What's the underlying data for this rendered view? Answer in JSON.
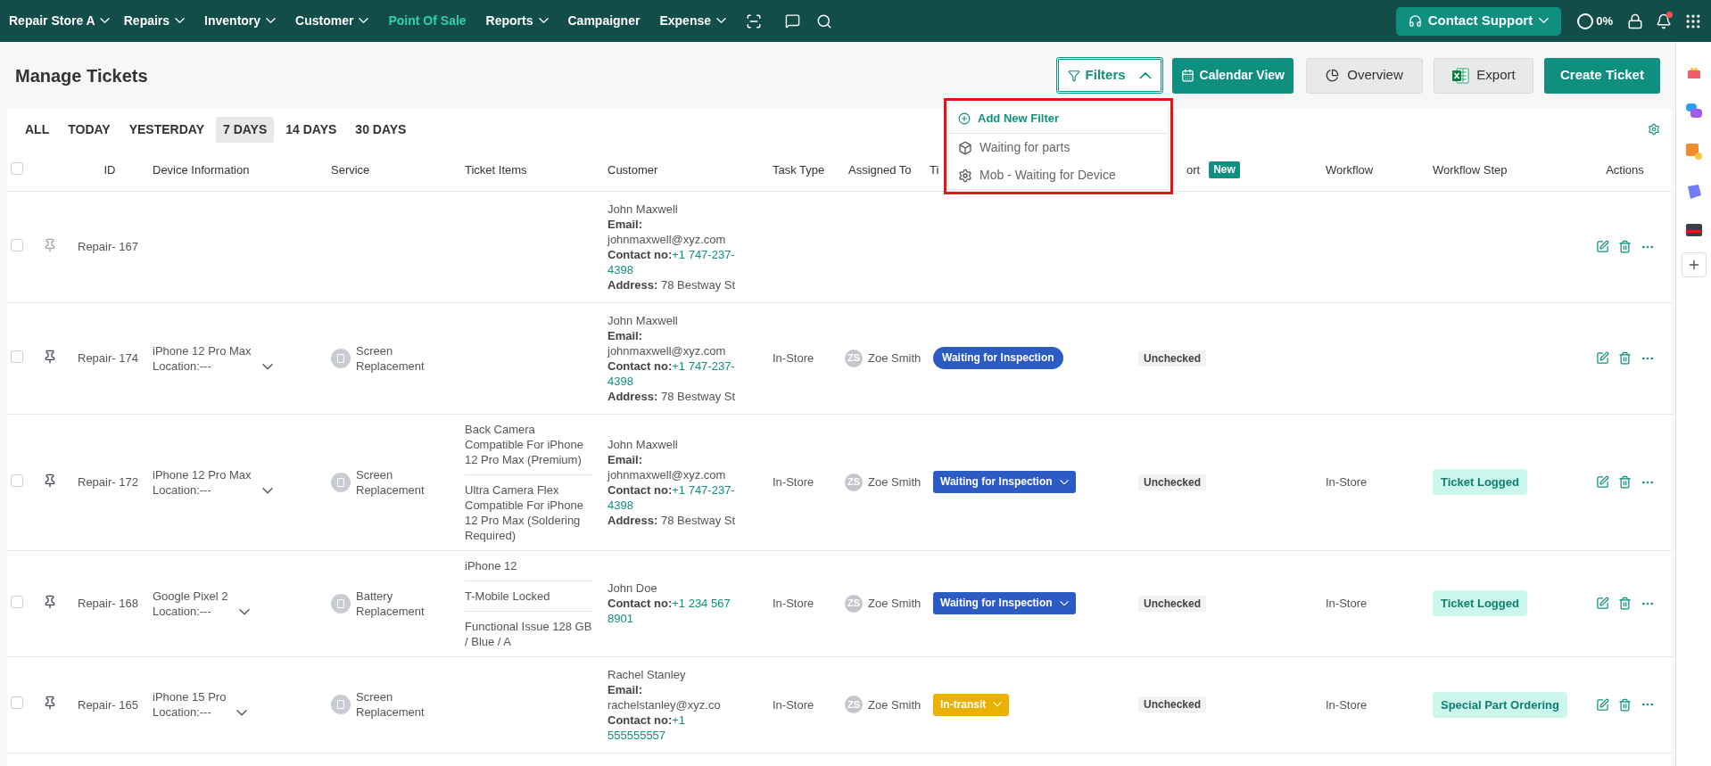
{
  "nav": {
    "store": "Repair Store A",
    "items": [
      {
        "label": "Repairs",
        "has_menu": true,
        "selected": false
      },
      {
        "label": "Inventory",
        "has_menu": true,
        "selected": false
      },
      {
        "label": "Customer",
        "has_menu": true,
        "selected": false
      },
      {
        "label": "Point Of Sale",
        "has_menu": false,
        "selected": true
      },
      {
        "label": "Reports",
        "has_menu": true,
        "selected": false
      },
      {
        "label": "Campaigner",
        "has_menu": false,
        "selected": false
      },
      {
        "label": "Expense",
        "has_menu": true,
        "selected": false
      }
    ],
    "contact_support": "Contact Support",
    "progress": "0%",
    "has_notification": true
  },
  "page": {
    "title": "Manage Tickets"
  },
  "toolbar": {
    "filters": {
      "label": "Filters",
      "expanded": true
    },
    "calendar": "Calendar View",
    "overview": "Overview",
    "export": "Export",
    "create": "Create Ticket"
  },
  "filter_menu": {
    "add": "Add New Filter",
    "items": [
      {
        "label": "Waiting for parts",
        "kind": "box"
      },
      {
        "label": "Mob - Waiting for Device",
        "kind": "gear"
      }
    ]
  },
  "date_tabs": [
    {
      "label": "ALL",
      "selected": false
    },
    {
      "label": "TODAY",
      "selected": false
    },
    {
      "label": "YESTERDAY",
      "selected": false
    },
    {
      "label": "7 DAYS",
      "selected": true
    },
    {
      "label": "14 DAYS",
      "selected": false
    },
    {
      "label": "30 DAYS",
      "selected": false
    }
  ],
  "table": {
    "all_checked": false,
    "columns": [
      {
        "label": "ID"
      },
      {
        "label": "Device Information"
      },
      {
        "label": "Service"
      },
      {
        "label": "Ticket Items"
      },
      {
        "label": "Customer"
      },
      {
        "label": "Task Type"
      },
      {
        "label": "Assigned To"
      },
      {
        "label": "Ti"
      },
      {
        "label": "ort",
        "badge": "New"
      },
      {
        "label": "Workflow"
      },
      {
        "label": "Workflow Step"
      },
      {
        "label": "Actions"
      }
    ],
    "rows": [
      {
        "checked": false,
        "pinned": false,
        "id": "Repair- 167",
        "ticket_items": [],
        "customer": {
          "name": "John Maxwell",
          "fields": [
            {
              "label": "Email:",
              "value": "johnmaxwell@xyz.com",
              "kind": "email"
            },
            {
              "label": "Contact no:",
              "value": "+1 747-237-4398",
              "kind": "phone"
            },
            {
              "label": "Address:",
              "value": "78 Bestway St",
              "kind": "text"
            }
          ]
        }
      },
      {
        "checked": false,
        "pinned": true,
        "id": "Repair- 174",
        "device": {
          "name": "iPhone 12 Pro Max",
          "location": "Location:---"
        },
        "service": "Screen Replacement",
        "ticket_items": [],
        "customer": {
          "name": "John Maxwell",
          "fields": [
            {
              "label": "Email:",
              "value": "johnmaxwell@xyz.com",
              "kind": "email"
            },
            {
              "label": "Contact no:",
              "value": "+1 747-237-4398",
              "kind": "phone"
            },
            {
              "label": "Address:",
              "value": "78 Bestway St",
              "kind": "text"
            }
          ]
        },
        "task_type": "In-Store",
        "assignee": {
          "initials": "ZS",
          "name": "Zoe Smith"
        },
        "status": {
          "label": "Waiting for Inspection",
          "kind": "pill",
          "color": "#2d5bc4"
        },
        "report": "Unchecked"
      },
      {
        "checked": false,
        "pinned": true,
        "id": "Repair- 172",
        "device": {
          "name": "iPhone 12 Pro Max",
          "location": "Location:---"
        },
        "service": "Screen Replacement",
        "ticket_items": [
          "Back Camera Compatible For iPhone 12 Pro Max (Premium)",
          "Ultra Camera Flex Compatible For iPhone 12 Pro Max (Soldering Required)"
        ],
        "customer": {
          "name": "John Maxwell",
          "fields": [
            {
              "label": "Email:",
              "value": "johnmaxwell@xyz.com",
              "kind": "email"
            },
            {
              "label": "Contact no:",
              "value": "+1 747-237-4398",
              "kind": "phone"
            },
            {
              "label": "Address:",
              "value": "78 Bestway St",
              "kind": "text"
            }
          ]
        },
        "task_type": "In-Store",
        "assignee": {
          "initials": "ZS",
          "name": "Zoe Smith"
        },
        "status": {
          "label": "Waiting for Inspection",
          "kind": "dropdown",
          "color": "#2d5bc4"
        },
        "report": "Unchecked",
        "workflow": "In-Store",
        "workflow_step": "Ticket Logged"
      },
      {
        "checked": false,
        "pinned": true,
        "id": "Repair- 168",
        "device": {
          "name": "Google Pixel 2",
          "location": "Location:---"
        },
        "service": "Battery Replacement",
        "ticket_items": [
          "iPhone 12",
          "T-Mobile Locked",
          "Functional Issue 128 GB / Blue / A"
        ],
        "customer": {
          "name": "John Doe",
          "fields": [
            {
              "label": "Contact no:",
              "value": "+1 234 567 8901",
              "kind": "phone"
            }
          ]
        },
        "task_type": "In-Store",
        "assignee": {
          "initials": "ZS",
          "name": "Zoe Smith"
        },
        "status": {
          "label": "Waiting for Inspection",
          "kind": "dropdown",
          "color": "#2d5bc4"
        },
        "report": "Unchecked",
        "workflow": "In-Store",
        "workflow_step": "Ticket Logged"
      },
      {
        "checked": false,
        "pinned": true,
        "id": "Repair- 165",
        "device": {
          "name": "iPhone 15 Pro",
          "location": "Location:---"
        },
        "service": "Screen Replacement",
        "ticket_items": [],
        "customer": {
          "name": "Rachel Stanley",
          "fields": [
            {
              "label": "Email:",
              "value": "rachelstanley@xyz.co",
              "kind": "email"
            },
            {
              "label": "Contact no:",
              "value": "+1 555555557",
              "kind": "phone"
            }
          ]
        },
        "task_type": "In-Store",
        "assignee": {
          "initials": "ZS",
          "name": "Zoe Smith"
        },
        "status": {
          "label": "In-transit",
          "kind": "dropdown",
          "color": "#e9b100"
        },
        "report": "Unchecked",
        "workflow": "In-Store",
        "workflow_step": "Special Part Ordering"
      }
    ]
  }
}
